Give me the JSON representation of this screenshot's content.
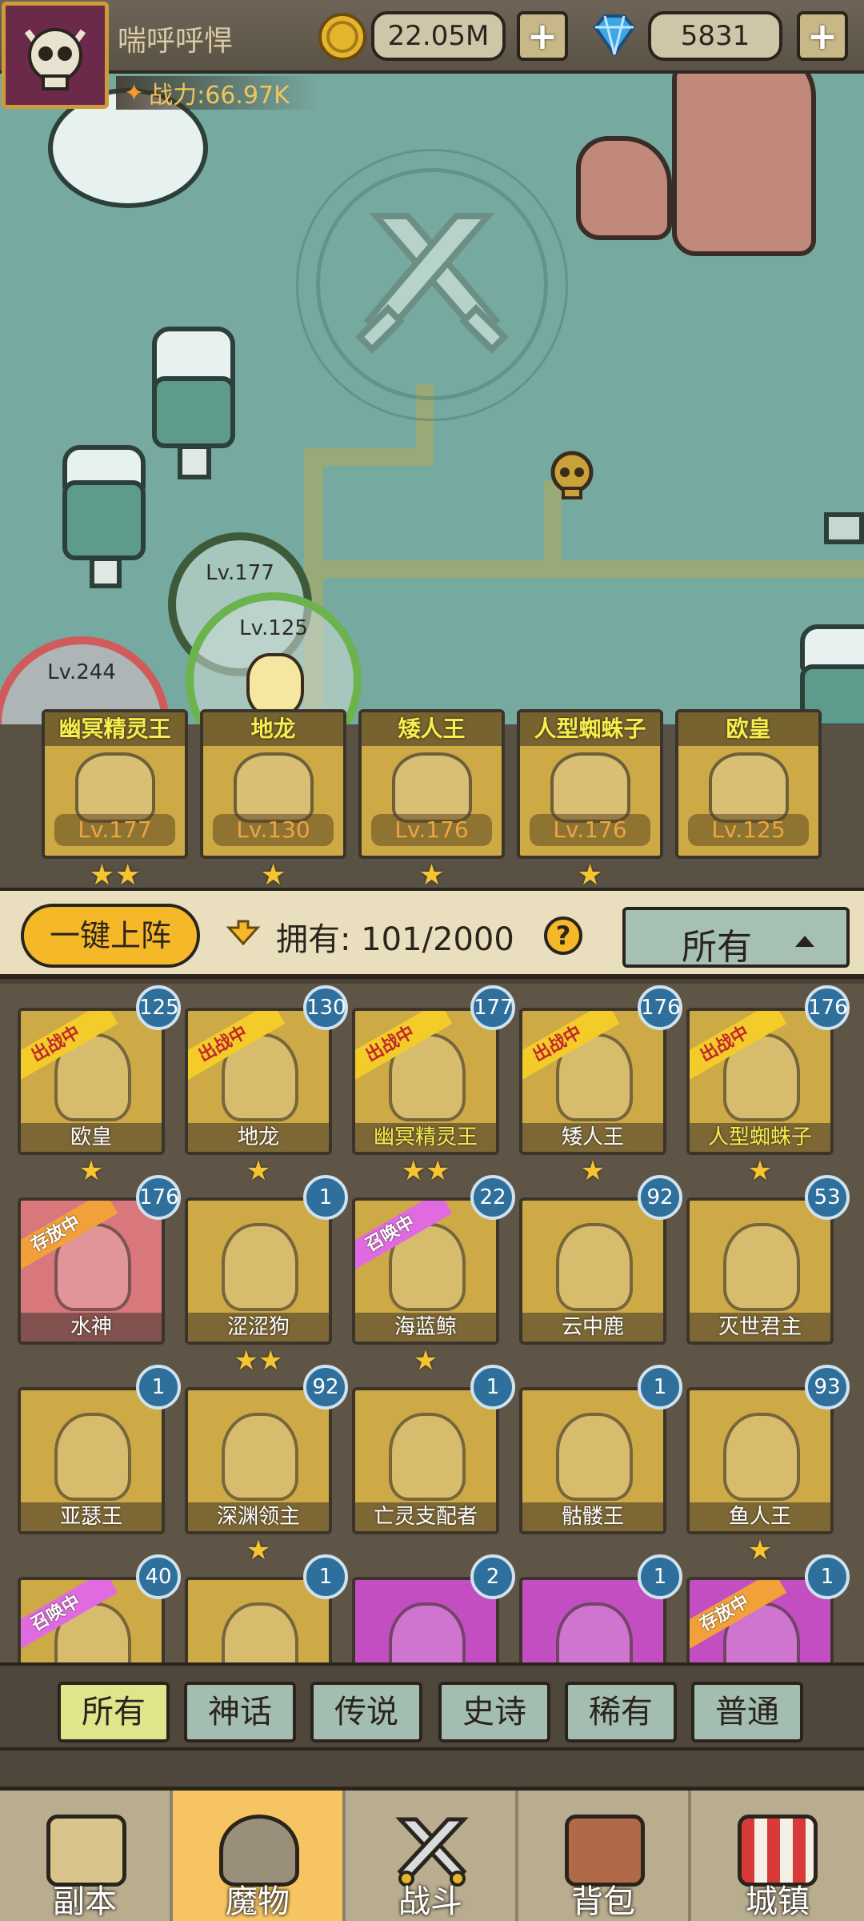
{
  "player": {
    "name": "喘呼呼悍",
    "power": "战力:66.97K"
  },
  "resources": {
    "gold": "22.05M",
    "gems": "5831",
    "plus": "+"
  },
  "map": {
    "bubbles": [
      {
        "level": "Lv.177"
      },
      {
        "level": "Lv.125"
      },
      {
        "level": "Lv.244"
      }
    ]
  },
  "team": [
    {
      "name": "幽冥精灵王",
      "level": "Lv.177",
      "stars": "★★"
    },
    {
      "name": "地龙",
      "level": "Lv.130",
      "stars": "★"
    },
    {
      "name": "矮人王",
      "level": "Lv.176",
      "stars": "★"
    },
    {
      "name": "人型蜘蛛子",
      "level": "Lv.176",
      "stars": "★"
    },
    {
      "name": "欧皇",
      "level": "Lv.125",
      "stars": ""
    }
  ],
  "toolbar": {
    "auto_deploy": "一键上阵",
    "owned": "拥有: 101/2000",
    "help": "?",
    "filter": "所有"
  },
  "monsters": [
    {
      "name": "欧皇",
      "count": "125",
      "status": "出战中",
      "stars": "★",
      "color": "gold",
      "name_color": "white"
    },
    {
      "name": "地龙",
      "count": "130",
      "status": "出战中",
      "stars": "★",
      "color": "gold",
      "name_color": "white"
    },
    {
      "name": "幽冥精灵王",
      "count": "177",
      "status": "出战中",
      "stars": "★★",
      "color": "gold",
      "name_color": "yellow"
    },
    {
      "name": "矮人王",
      "count": "176",
      "status": "出战中",
      "stars": "★",
      "color": "gold",
      "name_color": "white"
    },
    {
      "name": "人型蜘蛛子",
      "count": "176",
      "status": "出战中",
      "stars": "★",
      "color": "gold",
      "name_color": "yellow"
    },
    {
      "name": "水神",
      "count": "176",
      "status": "存放中",
      "stars": "",
      "color": "red",
      "name_color": "white"
    },
    {
      "name": "涩涩狗",
      "count": "1",
      "status": "",
      "stars": "★★",
      "color": "gold",
      "name_color": "white"
    },
    {
      "name": "海蓝鲸",
      "count": "22",
      "status": "召唤中",
      "stars": "★",
      "color": "gold",
      "name_color": "white"
    },
    {
      "name": "云中鹿",
      "count": "92",
      "status": "",
      "stars": "",
      "color": "gold",
      "name_color": "white"
    },
    {
      "name": "灭世君主",
      "count": "53",
      "status": "",
      "stars": "",
      "color": "gold",
      "name_color": "white"
    },
    {
      "name": "亚瑟王",
      "count": "1",
      "status": "",
      "stars": "",
      "color": "gold",
      "name_color": "white"
    },
    {
      "name": "深渊领主",
      "count": "92",
      "status": "",
      "stars": "★",
      "color": "gold",
      "name_color": "white"
    },
    {
      "name": "亡灵支配者",
      "count": "1",
      "status": "",
      "stars": "",
      "color": "gold",
      "name_color": "white"
    },
    {
      "name": "骷髅王",
      "count": "1",
      "status": "",
      "stars": "",
      "color": "gold",
      "name_color": "white"
    },
    {
      "name": "鱼人王",
      "count": "93",
      "status": "",
      "stars": "★",
      "color": "gold",
      "name_color": "white"
    },
    {
      "name": "",
      "count": "40",
      "status": "召唤中",
      "stars": "",
      "color": "gold",
      "name_color": "white"
    },
    {
      "name": "",
      "count": "1",
      "status": "",
      "stars": "",
      "color": "gold",
      "name_color": "white"
    },
    {
      "name": "",
      "count": "2",
      "status": "",
      "stars": "",
      "color": "purple",
      "name_color": "white"
    },
    {
      "name": "",
      "count": "1",
      "status": "",
      "stars": "",
      "color": "purple",
      "name_color": "white"
    },
    {
      "name": "",
      "count": "1",
      "status": "存放中",
      "stars": "",
      "color": "purple",
      "name_color": "white"
    }
  ],
  "rarity_tabs": [
    "所有",
    "神话",
    "传说",
    "史诗",
    "稀有",
    "普通"
  ],
  "bottom_nav": [
    {
      "label": "副本",
      "icon": "map-icon"
    },
    {
      "label": "魔物",
      "icon": "helmet-icon"
    },
    {
      "label": "战斗",
      "icon": "swords-icon"
    },
    {
      "label": "背包",
      "icon": "backpack-icon"
    },
    {
      "label": "城镇",
      "icon": "shop-icon"
    }
  ],
  "colors": {
    "gold_card": "#cdaa45",
    "red_card": "#d9787c",
    "purple_card": "#c24ec2",
    "active_nav": "#f6c462",
    "active_rarity": "#dfe58a"
  }
}
